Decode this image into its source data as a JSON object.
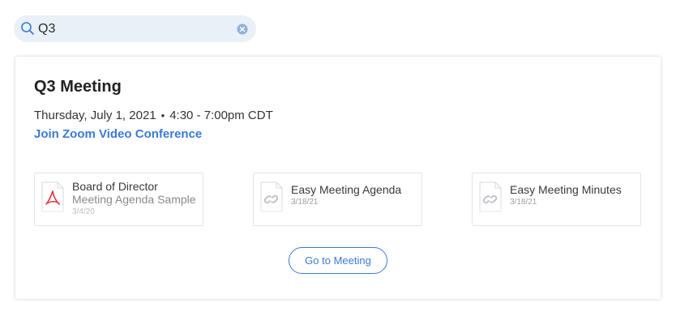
{
  "search": {
    "value": "Q3",
    "icon": "search-icon",
    "clear_icon": "clear-icon"
  },
  "meeting": {
    "title": "Q3 Meeting",
    "date": "Thursday, July 1, 2021",
    "separator": "•",
    "time": "4:30 - 7:00pm CDT",
    "join_link": "Join Zoom Video Conference"
  },
  "files": [
    {
      "name": "Board of Director",
      "subtitle": "Meeting Agenda Sample",
      "date": "3/4/20",
      "icon": "pdf-icon"
    },
    {
      "name": "Easy Meeting Agenda",
      "subtitle": "",
      "date": "3/18/21",
      "icon": "link-icon"
    },
    {
      "name": "Easy Meeting Minutes",
      "subtitle": "",
      "date": "3/18/21",
      "icon": "link-icon"
    }
  ],
  "actions": {
    "go_to_meeting": "Go to Meeting"
  },
  "colors": {
    "accent": "#3a7bd5",
    "search_bg": "#eaf0f7",
    "pdf_red": "#e0323a"
  }
}
